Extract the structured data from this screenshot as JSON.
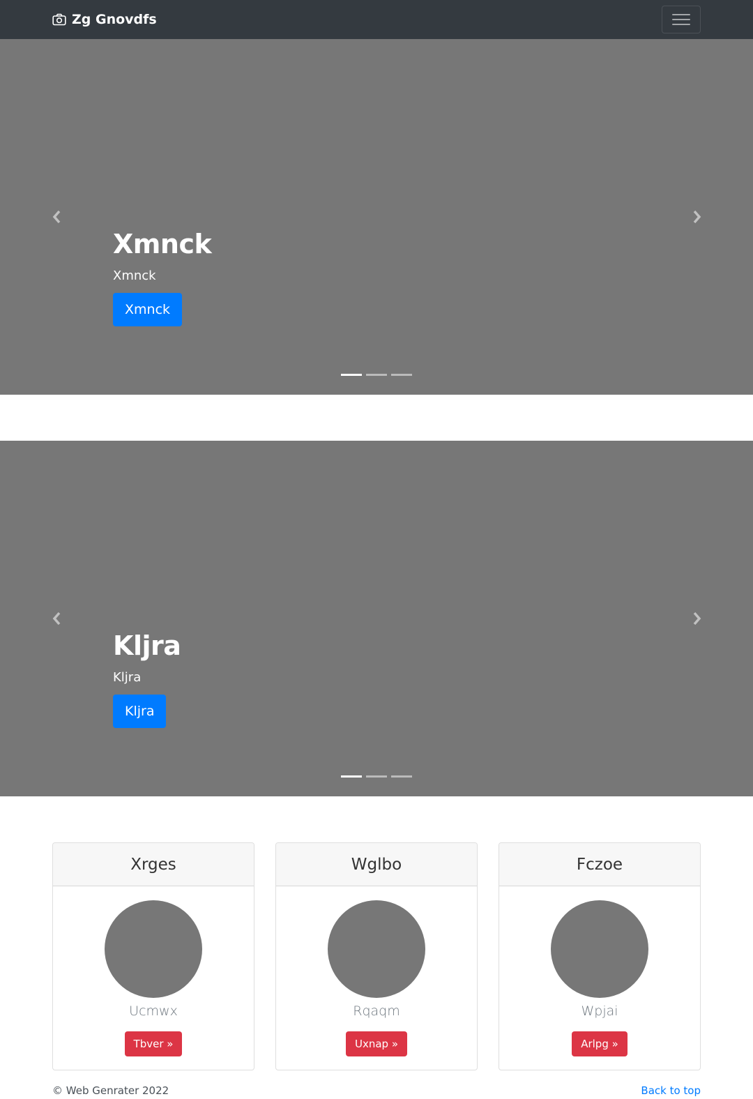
{
  "navbar": {
    "brand": "Zg Gnovdfs",
    "brand_icon": "camera-icon",
    "toggler_icon": "hamburger-menu-icon"
  },
  "carousels": [
    {
      "title": "Xmnck",
      "subtitle": "Xmnck",
      "button_label": "Xmnck",
      "slide_count": 3,
      "active_slide": 1
    },
    {
      "title": "Kljra",
      "subtitle": "Kljra",
      "button_label": "Kljra",
      "slide_count": 3,
      "active_slide": 1
    }
  ],
  "cards": [
    {
      "header": "Xrges",
      "subtitle": "Ucmwx",
      "button_label": "Tbver »"
    },
    {
      "header": "Wglbo",
      "subtitle": "Rqaqm",
      "button_label": "Uxnap »"
    },
    {
      "header": "Fczoe",
      "subtitle": "Wpjai",
      "button_label": "Arlpg »"
    }
  ],
  "footer": {
    "copyright": "© Web Genrater 2022",
    "back_to_top": "Back to top"
  },
  "colors": {
    "navbar_bg": "#343a40",
    "placeholder_gray": "#777777",
    "primary": "#007bff",
    "danger": "#dc3545"
  }
}
